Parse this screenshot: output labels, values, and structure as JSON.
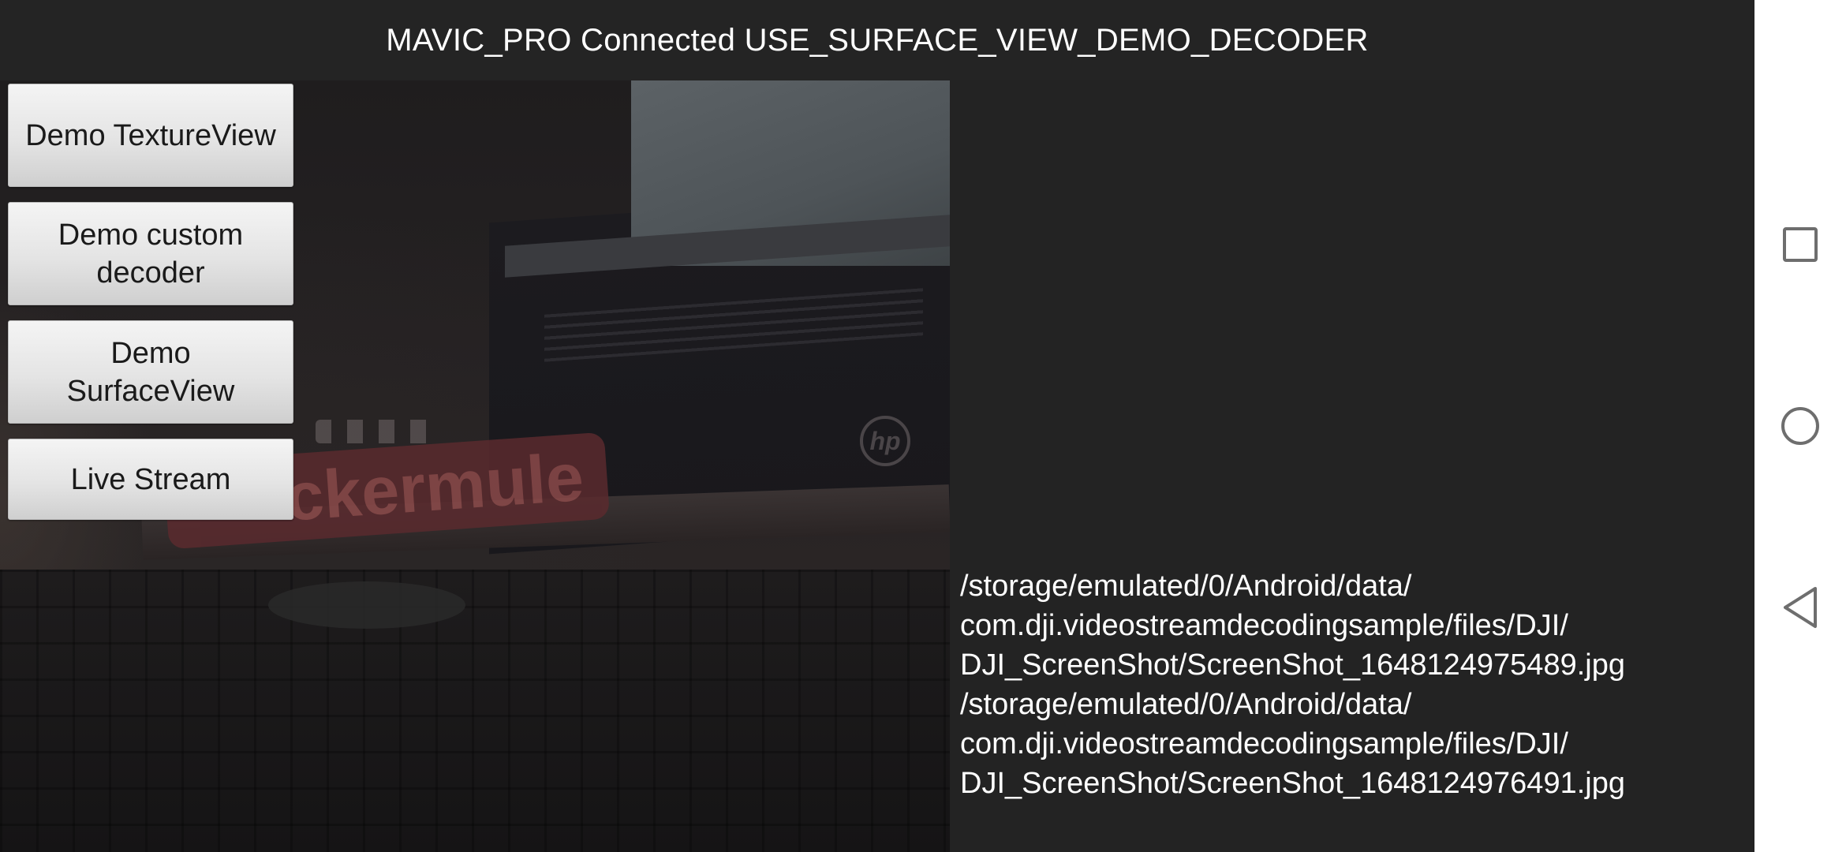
{
  "header": {
    "title": "MAVIC_PRO Connected USE_SURFACE_VIEW_DEMO_DECODER"
  },
  "video": {
    "sticker_text": "ckermule",
    "logo_text": "hp"
  },
  "buttons": [
    {
      "label": "Demo TextureView"
    },
    {
      "label": "Demo custom decoder"
    },
    {
      "label": "Demo SurfaceView"
    },
    {
      "label": "Live Stream"
    }
  ],
  "log": {
    "lines": [
      "/storage/emulated/0/Android/data/",
      "com.dji.videostreamdecodingsample/files/DJI/",
      "DJI_ScreenShot/ScreenShot_1648124975489.jpg",
      "/storage/emulated/0/Android/data/",
      "com.dji.videostreamdecodingsample/files/DJI/",
      "DJI_ScreenShot/ScreenShot_1648124976491.jpg"
    ]
  },
  "navbar": {
    "icons": [
      "recents-icon",
      "home-icon",
      "back-icon"
    ]
  },
  "colors": {
    "background": "#232323",
    "button": "#e4e4e4",
    "navbar": "#ffffff",
    "text": "#ffffff"
  }
}
